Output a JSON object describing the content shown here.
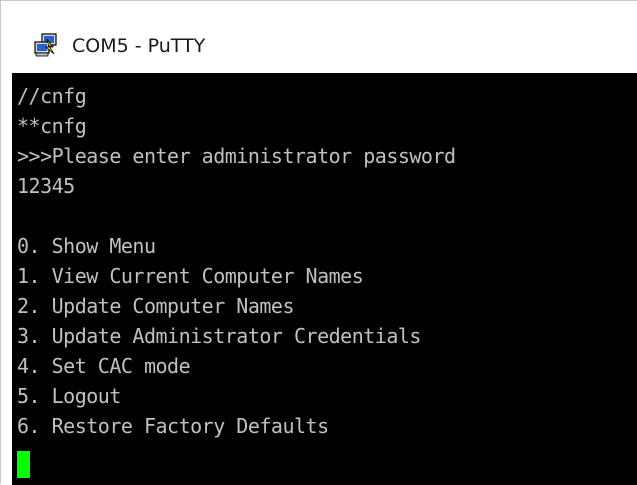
{
  "window": {
    "title": "COM5 - PuTTY"
  },
  "terminal": {
    "lines": [
      "//cnfg",
      "**cnfg",
      ">>>Please enter administrator password",
      "12345",
      "",
      "0. Show Menu",
      "1. View Current Computer Names",
      "2. Update Computer Names",
      "3. Update Administrator Credentials",
      "4. Set CAC mode",
      "5. Logout",
      "6. Restore Factory Defaults"
    ],
    "foreground_color": "#c0c0c0",
    "background_color": "#000000",
    "cursor_color": "#00ff00"
  },
  "icons": {
    "app": "putty-icon"
  }
}
